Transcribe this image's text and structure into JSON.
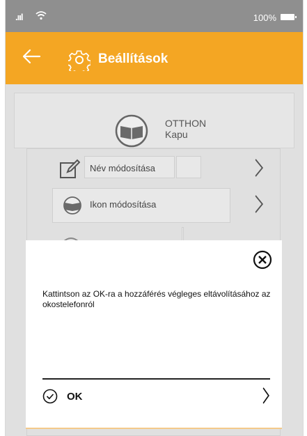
{
  "status_bar": {
    "signal": ".ııl",
    "wifi": "≈",
    "battery_text": "100%"
  },
  "header": {
    "title": "Beállítások",
    "back_icon": "arrow-left-icon",
    "settings_icon": "gear-icon",
    "bg": "#f4a623"
  },
  "device": {
    "name": "OTTHON",
    "sub": "Kapu",
    "icon": "gate-icon"
  },
  "menu": {
    "items": [
      {
        "label": "Név módosítása",
        "icon": "edit-icon"
      },
      {
        "label": "Ikon módosítása",
        "icon": "gate-icon"
      },
      {
        "label": "",
        "icon": "wireless-icon"
      }
    ]
  },
  "dialog": {
    "message": "Kattintson az OK-ra a hozzáférés végleges eltávolításához az okostelefonról",
    "ok_label": "OK",
    "close_icon": "close-circle-icon",
    "check_icon": "check-circle-icon",
    "arrow_icon": "chevron-right-icon"
  }
}
